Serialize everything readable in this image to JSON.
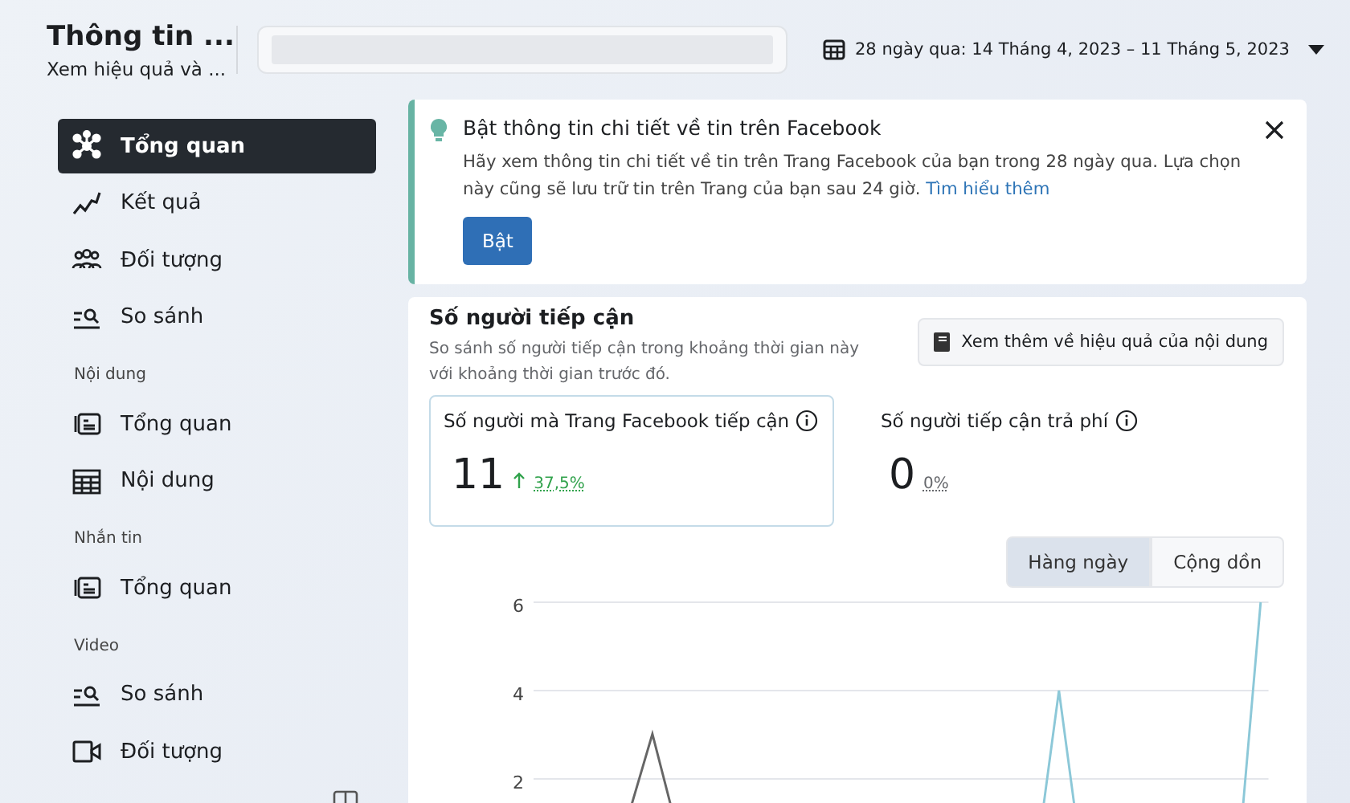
{
  "header": {
    "title": "Thông tin ...",
    "subtitle": "Xem hiệu quả và ...",
    "date_range": "28 ngày qua: 14 Tháng 4, 2023 – 11 Tháng 5, 2023"
  },
  "sidebar": {
    "sections": [
      {
        "items": [
          {
            "label": "Tổng quan",
            "kind": "nodes",
            "selected": true
          },
          {
            "label": "Kết quả",
            "kind": "trend",
            "selected": false
          },
          {
            "label": "Đối tượng",
            "kind": "people",
            "selected": false
          },
          {
            "label": "So sánh",
            "kind": "compare",
            "selected": false
          }
        ]
      },
      {
        "heading": "Nội dung",
        "items": [
          {
            "label": "Tổng quan",
            "kind": "cards",
            "selected": false
          },
          {
            "label": "Nội dung",
            "kind": "table",
            "selected": false
          }
        ]
      },
      {
        "heading": "Nhắn tin",
        "items": [
          {
            "label": "Tổng quan",
            "kind": "cards",
            "selected": false
          }
        ]
      },
      {
        "heading": "Video",
        "items": [
          {
            "label": "So sánh",
            "kind": "compare",
            "selected": false
          },
          {
            "label": "Đối tượng",
            "kind": "video",
            "selected": false
          }
        ]
      }
    ]
  },
  "notice": {
    "title": "Bật thông tin chi tiết về tin trên Facebook",
    "body": "Hãy xem thông tin chi tiết về tin trên Trang Facebook của bạn trong 28 ngày qua. Lựa chọn này cũng sẽ lưu trữ tin trên Trang của bạn sau 24 giờ.",
    "link": "Tìm hiểu thêm",
    "button": "Bật"
  },
  "reach": {
    "title": "Số người tiếp cận",
    "description": "So sánh số người tiếp cận trong khoảng thời gian này với khoảng thời gian trước đó.",
    "more_button": "Xem thêm về hiệu quả của nội dung",
    "metrics": [
      {
        "label": "Số người mà Trang Facebook tiếp cận",
        "value": "11",
        "change": "37,5%",
        "kind": "rising",
        "selected": true
      },
      {
        "label": "Số người tiếp cận trả phí",
        "value": "0",
        "change": "0%",
        "kind": "flat",
        "selected": false
      }
    ],
    "toggle": [
      {
        "label": "Hàng ngày",
        "selected": true
      },
      {
        "label": "Cộng dồn",
        "selected": false
      }
    ],
    "y_axis_labels": [
      "6",
      "4",
      "2"
    ]
  }
}
